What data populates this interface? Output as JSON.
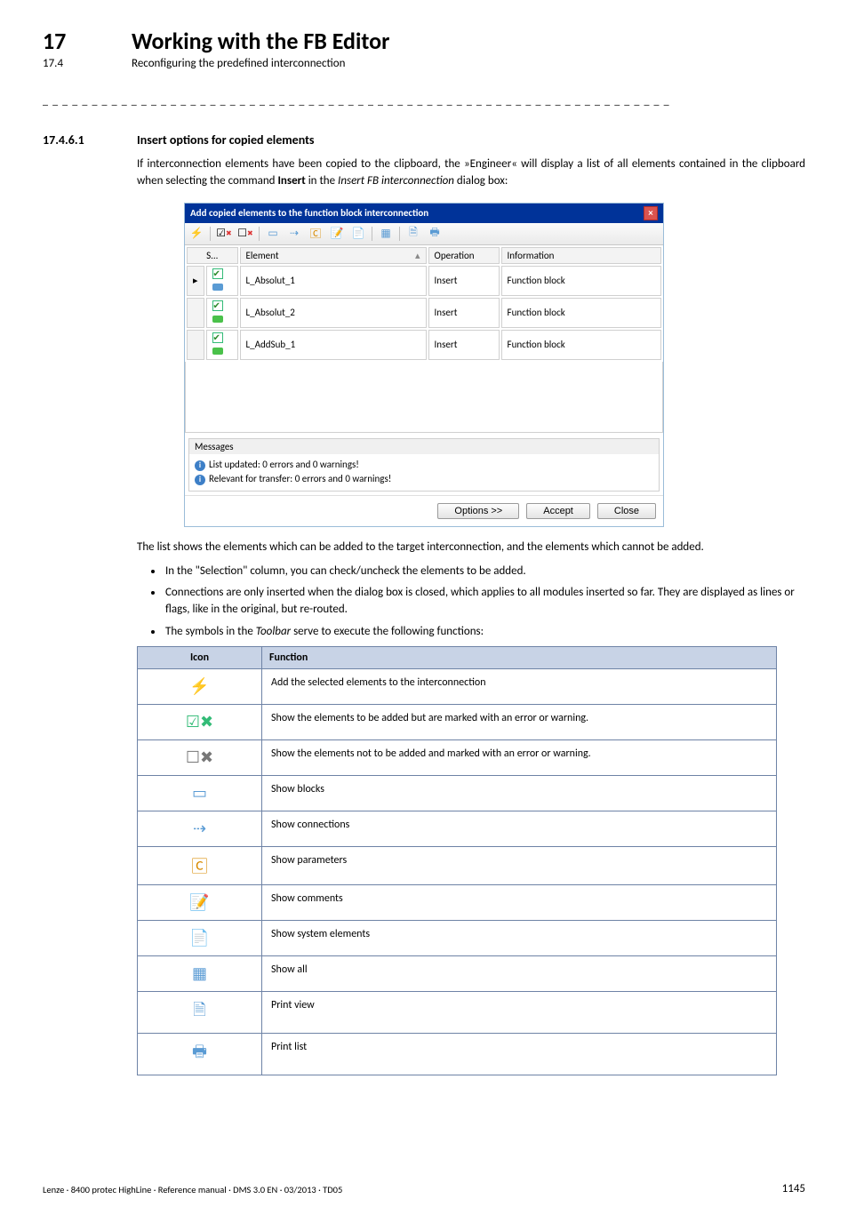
{
  "header": {
    "chapter_num": "17",
    "chapter_title": "Working with the FB Editor",
    "section_num": "17.4",
    "section_title": "Reconfiguring the predefined interconnection"
  },
  "section_heading": {
    "num": "17.4.6.1",
    "title": "Insert options for copied elements"
  },
  "para1_pre": "If interconnection elements have been copied to the clipboard, the »Engineer« will display a list of all elements contained in the clipboard when selecting the command ",
  "para1_bold": "Insert",
  "para1_mid": " in the ",
  "para1_italic": "Insert FB interconnection",
  "para1_post": " dialog box:",
  "dialog": {
    "title": "Add copied elements to the function block interconnection",
    "columns": {
      "sel": "S...",
      "element": "Element",
      "operation": "Operation",
      "information": "Information"
    },
    "rows": [
      {
        "element": "L_Absolut_1",
        "operation": "Insert",
        "info": "Function block"
      },
      {
        "element": "L_Absolut_2",
        "operation": "Insert",
        "info": "Function block"
      },
      {
        "element": "L_AddSub_1",
        "operation": "Insert",
        "info": "Function block"
      }
    ],
    "messages_label": "Messages",
    "msg1": "List updated: 0 errors and 0 warnings!",
    "msg2": "Relevant for transfer: 0 errors and 0 warnings!",
    "buttons": {
      "options": "Options >>",
      "accept": "Accept",
      "close": "Close"
    }
  },
  "para2": "The list shows the elements which can be added to the target interconnection, and the elements which cannot be added.",
  "bullets": {
    "b1": "In the \"Selection\" column, you can check/uncheck the elements to be added.",
    "b2": "Connections are only inserted when the dialog box is closed, which applies to all modules inserted so far. They are displayed as lines or flags, like in the original, but re-routed.",
    "b3_pre": "The symbols in the ",
    "b3_italic": "Toolbar",
    "b3_post": " serve to execute the following functions:"
  },
  "func_table": {
    "h_icon": "Icon",
    "h_func": "Function",
    "rows": [
      {
        "icon": "⚡",
        "name": "add-selected-icon",
        "func": "Add the selected elements to the interconnection"
      },
      {
        "icon": "☑✖",
        "name": "show-add-warning-icon",
        "func": "Show the elements to be added but are marked with an error or warning."
      },
      {
        "icon": "☐✖",
        "name": "show-notadd-warning-icon",
        "func": "Show the elements not to be added and marked with an error or warning."
      },
      {
        "icon": "▭",
        "name": "show-blocks-icon",
        "func": "Show blocks"
      },
      {
        "icon": "⇢",
        "name": "show-connections-icon",
        "func": "Show connections"
      },
      {
        "icon": "🄲",
        "name": "show-parameters-icon",
        "func": "Show parameters"
      },
      {
        "icon": "📝",
        "name": "show-comments-icon",
        "func": "Show comments"
      },
      {
        "icon": "📄",
        "name": "show-system-elements-icon",
        "func": "Show system elements"
      },
      {
        "icon": "▦",
        "name": "show-all-icon",
        "func": "Show all"
      },
      {
        "icon": "🗎",
        "name": "print-view-icon",
        "func": "Print view"
      },
      {
        "icon": "🖶",
        "name": "print-list-icon",
        "func": "Print list"
      }
    ]
  },
  "footer": {
    "left": "Lenze · 8400 protec HighLine · Reference manual · DMS 3.0 EN · 03/2013 · TD05",
    "page": "1145"
  }
}
